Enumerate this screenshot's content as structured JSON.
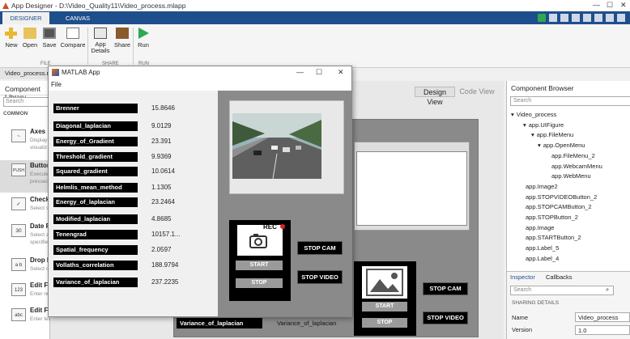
{
  "window": {
    "title": "App Designer - D:\\Video_Quality11\\Video_process.mlapp"
  },
  "tabs": {
    "designer": "DESIGNER",
    "canvas": "CANVAS"
  },
  "toolstrip": {
    "new": "New",
    "open": "Open",
    "save": "Save",
    "compare": "Compare",
    "app_details": "App\nDetails",
    "share": "Share",
    "run": "Run",
    "sections": {
      "file": "FILE",
      "share": "SHARE",
      "run": "RUN"
    }
  },
  "file_tab": "Video_process.mlapp",
  "component_library": {
    "header": "Component Library",
    "search_placeholder": "Search",
    "group": "COMMON",
    "items": [
      {
        "name": "Axes",
        "desc": "Display\nvisualiz",
        "icon": "axes-icon",
        "glyph": "~"
      },
      {
        "name": "Button",
        "desc": "Execute\npressed",
        "icon": "push-button-icon",
        "glyph": "PUSH"
      },
      {
        "name": "Check Box",
        "desc": "Select s",
        "icon": "check-icon",
        "glyph": "✓"
      },
      {
        "name": "Date Picker",
        "desc": "Select a\nspecifie",
        "icon": "calendar-icon",
        "glyph": "30"
      },
      {
        "name": "Drop Down",
        "desc": "Select o",
        "icon": "dropdown-icon",
        "glyph": "a b"
      },
      {
        "name": "Edit Field",
        "desc": "Enter nu",
        "icon": "numeric-field-icon",
        "glyph": "123"
      },
      {
        "name": "Edit Field",
        "desc": "Enter text data",
        "icon": "text-field-icon",
        "glyph": "abc"
      }
    ]
  },
  "views": {
    "design": "Design View",
    "code": "Code View"
  },
  "app_window": {
    "title": "MATLAB App",
    "menu": "File",
    "metrics": [
      {
        "label": "Brenner",
        "value": "15.8646"
      },
      {
        "label": "Diagonal_laplacian",
        "value": "9.0129"
      },
      {
        "label": "Energy_of_Gradient",
        "value": "23.391"
      },
      {
        "label": "Threshold_gradient",
        "value": "9.9369"
      },
      {
        "label": "Squared_gradient",
        "value": "10.0614"
      },
      {
        "label": "Helmlis_mean_method",
        "value": "1.1305"
      },
      {
        "label": "Energy_of_laplacian",
        "value": "23.2464"
      },
      {
        "label": "Modified_laplacian",
        "value": "4.8685"
      },
      {
        "label": "Tenengrad",
        "value": "10157.1..."
      },
      {
        "label": "Spatial_frequency",
        "value": "2.0597"
      },
      {
        "label": "Vollaths_correlation",
        "value": "188.9794"
      },
      {
        "label": "Variance_of_laplacian",
        "value": "237.2235"
      }
    ],
    "rec": "REC",
    "start": "START",
    "stop": "STOP",
    "stop_cam": "STOP CAM",
    "stop_video": "STOP VIDEO"
  },
  "design_canvas": {
    "start": "START",
    "stop": "STOP",
    "stop_cam": "STOP CAM",
    "stop_video": "STOP VIDEO",
    "label": "Variance_of_laplacian",
    "label_value": "Variance_of_laplacian"
  },
  "component_browser": {
    "header": "Component Browser",
    "search_placeholder": "Search",
    "tree": [
      {
        "text": "Video_process",
        "level": 0,
        "arrow": "▾"
      },
      {
        "text": "app.UIFigure",
        "level": 1,
        "arrow": "▾"
      },
      {
        "text": "app.FileMenu",
        "level": 2,
        "arrow": "▾"
      },
      {
        "text": "app.OpenMenu",
        "level": 3,
        "arrow": "▾"
      },
      {
        "text": "app.FileMenu_2",
        "level": 4,
        "arrow": ""
      },
      {
        "text": "app.WebcamMenu",
        "level": 4,
        "arrow": ""
      },
      {
        "text": "app.WebMenu",
        "level": 4,
        "arrow": ""
      },
      {
        "text": "app.Image2",
        "level": 1,
        "arrow": ""
      },
      {
        "text": "app.STOPVIDEOButton_2",
        "level": 1,
        "arrow": ""
      },
      {
        "text": "app.STOPCAMButton_2",
        "level": 1,
        "arrow": ""
      },
      {
        "text": "app.STOPButton_2",
        "level": 1,
        "arrow": ""
      },
      {
        "text": "app.Image",
        "level": 1,
        "arrow": ""
      },
      {
        "text": "app.STARTButton_2",
        "level": 1,
        "arrow": ""
      },
      {
        "text": "app.Label_5",
        "level": 1,
        "arrow": ""
      },
      {
        "text": "app.Label_4",
        "level": 1,
        "arrow": ""
      }
    ],
    "inspector_tabs": {
      "inspector": "Inspector",
      "callbacks": "Callbacks"
    },
    "inspector_search": "Search",
    "sharing_details": "SHARING DETAILS",
    "name_label": "Name",
    "name_value": "Video_process",
    "version_label": "Version",
    "version_value": "1.0"
  },
  "colors": {
    "accent": "#1f4e8c",
    "rec_dot": "#e02020",
    "tab_active": "#f0f0f0"
  }
}
